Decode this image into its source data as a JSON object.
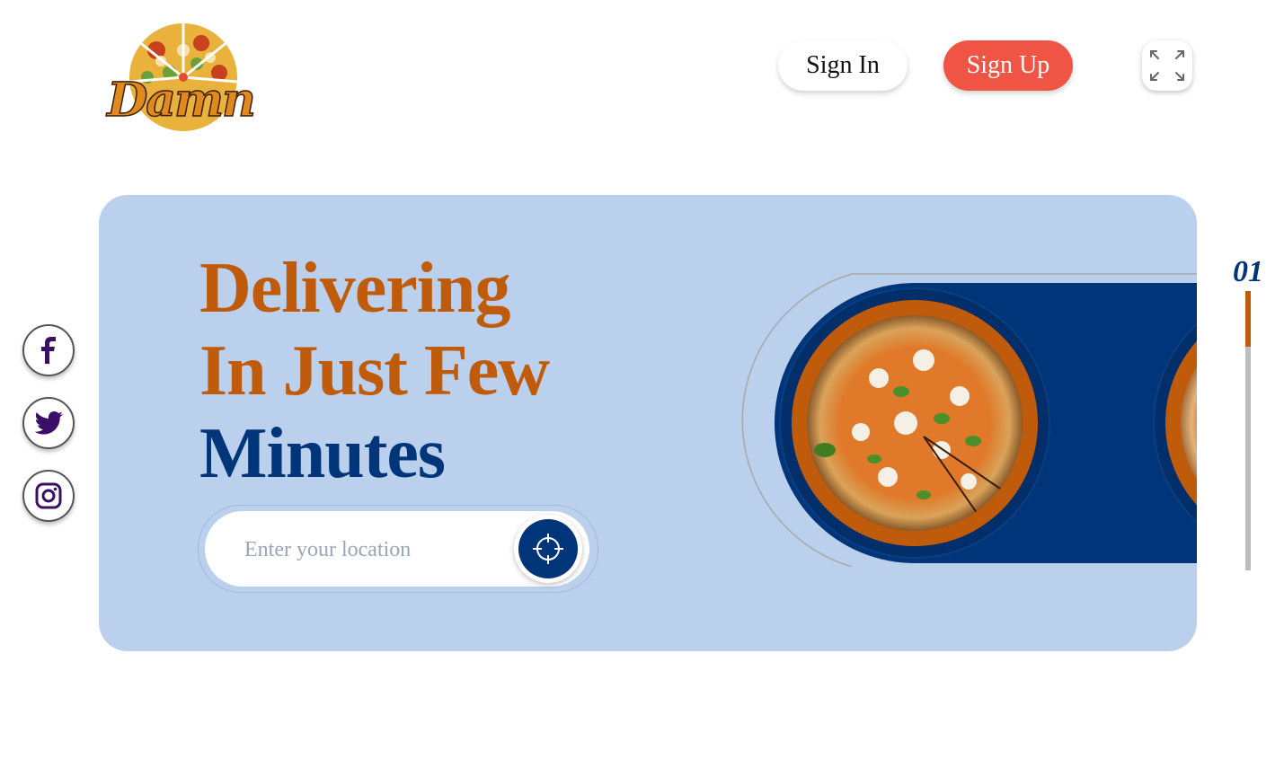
{
  "brand": {
    "logo_text": "Damn"
  },
  "header": {
    "signin_label": "Sign In",
    "signup_label": "Sign Up",
    "expand_icon": "expand-icon"
  },
  "social": [
    {
      "name": "facebook",
      "icon": "facebook-icon",
      "color": "#3b0f66"
    },
    {
      "name": "twitter",
      "icon": "twitter-icon",
      "color": "#3b0f66"
    },
    {
      "name": "instagram",
      "icon": "instagram-icon",
      "color": "#3b0f66"
    }
  ],
  "hero": {
    "line1": "Delivering",
    "line2": "In Just Few",
    "line3": "Minutes",
    "search_placeholder": "Enter your location",
    "locate_icon": "crosshair-icon"
  },
  "pager": {
    "current": "01",
    "progress": 0.2
  },
  "colors": {
    "accent_orange": "#bf5b0b",
    "navy": "#00357a",
    "hero_bg": "#bbd0ed",
    "signup_red": "#f05444"
  }
}
